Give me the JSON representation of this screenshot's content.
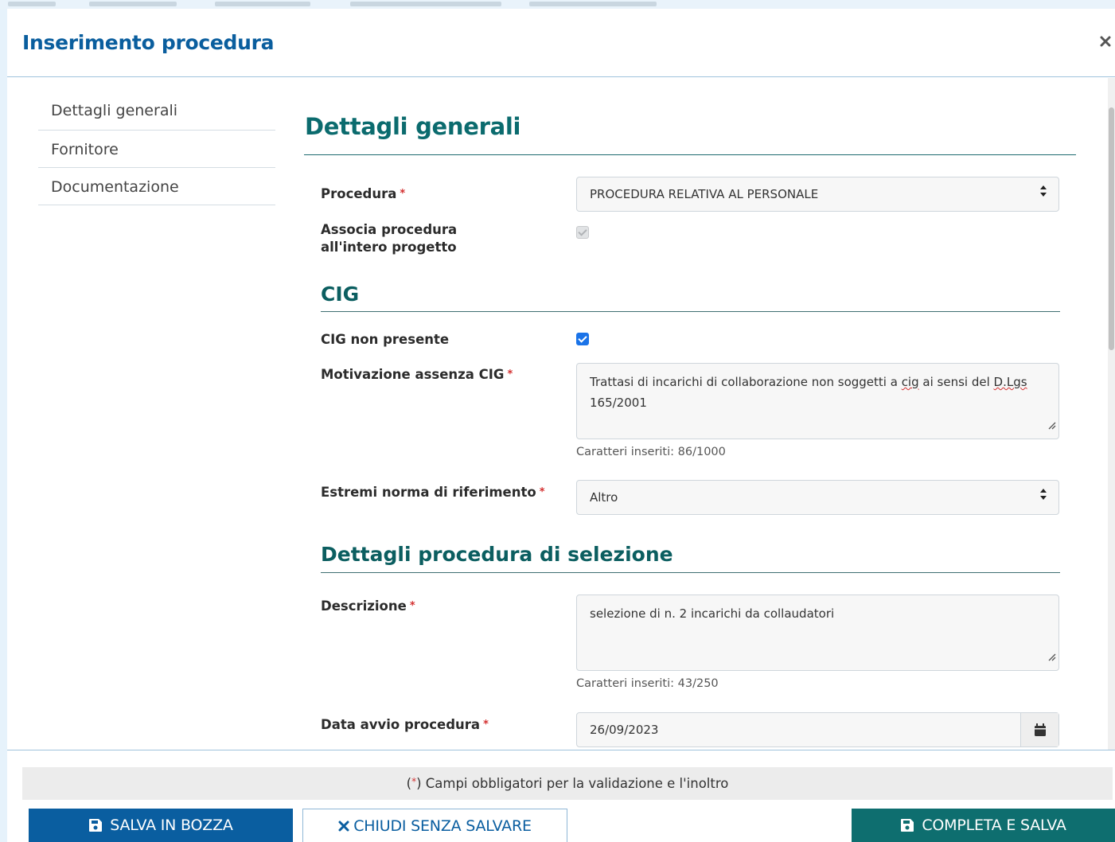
{
  "modal": {
    "title": "Inserimento procedura",
    "close_icon": "close-icon"
  },
  "side_nav": {
    "items": [
      {
        "label": "Dettagli generali"
      },
      {
        "label": "Fornitore"
      },
      {
        "label": "Documentazione"
      }
    ]
  },
  "form": {
    "section_title": "Dettagli generali",
    "required_marker": "*",
    "procedura": {
      "label": "Procedura",
      "value": "PROCEDURA RELATIVA AL PERSONALE"
    },
    "associa": {
      "label": "Associa procedura all'intero progetto",
      "checked": true,
      "disabled": true
    },
    "cig": {
      "title": "CIG",
      "non_presente_label": "CIG non presente",
      "non_presente_checked": true,
      "motivazione_label": "Motivazione assenza CIG",
      "motivazione_text_part1": "Trattasi di incarichi di collaborazione non soggetti a ",
      "motivazione_word_cig": "cig",
      "motivazione_text_part2": " ai sensi del ",
      "motivazione_word_dlgs": "D.Lgs",
      "motivazione_text_part3": " 165/2001",
      "motivazione_count": "Caratteri inseriti: 86/1000",
      "estremi_label": "Estremi norma di riferimento",
      "estremi_value": "Altro"
    },
    "selezione": {
      "title": "Dettagli procedura di selezione",
      "descrizione_label": "Descrizione",
      "descrizione_value": "selezione di n. 2 incarichi da collaudatori",
      "descrizione_count": "Caratteri inseriti: 43/250",
      "data_label": "Data avvio procedura",
      "data_value": "26/09/2023"
    }
  },
  "footer": {
    "required_note_prefix": "(",
    "required_note_star": "*",
    "required_note_suffix": ") Campi obbligatori per la validazione e l'inoltro",
    "save_draft": "SALVA IN BOZZA",
    "close_no_save": "CHIUDI SENZA SALVARE",
    "complete_save": "COMPLETA E SALVA"
  },
  "colors": {
    "primary_blue": "#0a5ea0",
    "teal": "#0e6e6f",
    "required_red": "#d32f2f",
    "checkbox_blue": "#1a73e8"
  }
}
